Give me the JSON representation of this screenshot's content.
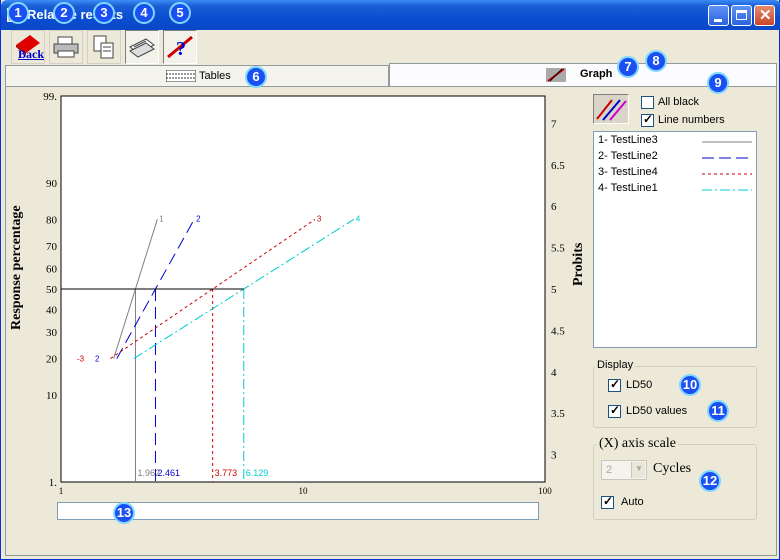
{
  "window": {
    "title": "Relative results"
  },
  "toolbar": {
    "back_label": "Back"
  },
  "tabs": {
    "tables_label": "Tables",
    "graph_label": "Graph"
  },
  "options": {
    "all_black_label": "All black",
    "all_black_checked": false,
    "line_numbers_label": "Line numbers",
    "line_numbers_checked": true
  },
  "legend": [
    {
      "label": "1- TestLine3",
      "color": "#808080",
      "style": "solid"
    },
    {
      "label": "2- TestLine2",
      "color": "#0000cc",
      "style": "dash"
    },
    {
      "label": "3- TestLine4",
      "color": "#cc0000",
      "style": "dot"
    },
    {
      "label": "4- TestLine1",
      "color": "#00cccc",
      "style": "dashdot"
    }
  ],
  "display": {
    "group_label": "Display",
    "ld50_label": "LD50",
    "ld50_checked": true,
    "ld50_values_label": "LD50 values",
    "ld50_values_checked": true
  },
  "xscale": {
    "group_label": "(X) axis scale",
    "cycles_value": "2",
    "cycles_label": "Cycles",
    "auto_label": "Auto",
    "auto_checked": true
  },
  "status_text": "",
  "callouts": [
    "1",
    "2",
    "3",
    "4",
    "5",
    "6",
    "7",
    "8",
    "9",
    "10",
    "11",
    "12",
    "13"
  ],
  "chart_data": {
    "type": "line",
    "title": "",
    "xlabel": "",
    "ylabel": "Response percentage",
    "y2label": "Probits",
    "xscale": "log",
    "xlim": [
      1,
      100
    ],
    "x_ticks": [
      "1",
      "10",
      "100"
    ],
    "ylim_probit": [
      2.67,
      7.33
    ],
    "y_left_ticks": [
      {
        "label": "99.",
        "probit": 7.33
      },
      {
        "label": "90",
        "probit": 6.28
      },
      {
        "label": "80",
        "probit": 5.84
      },
      {
        "label": "70",
        "probit": 5.52
      },
      {
        "label": "60",
        "probit": 5.25
      },
      {
        "label": "50",
        "probit": 5.0
      },
      {
        "label": "40",
        "probit": 4.75
      },
      {
        "label": "30",
        "probit": 4.48
      },
      {
        "label": "20",
        "probit": 4.16
      },
      {
        "label": "10",
        "probit": 3.72
      },
      {
        "label": "1.",
        "probit": 2.67
      }
    ],
    "y_right_ticks": [
      "7",
      "6.5",
      "6",
      "5.5",
      "5",
      "4.5",
      "4",
      "3.5",
      "3"
    ],
    "ld50_probit": 5,
    "series": [
      {
        "name": "1",
        "color": "#808080",
        "dash": "",
        "x": [
          1.65,
          2.5
        ],
        "y": [
          4.16,
          5.84
        ],
        "ld50": "1.962"
      },
      {
        "name": "2",
        "color": "#0000cc",
        "dash": "12,6",
        "x": [
          1.7,
          3.55
        ],
        "y": [
          4.16,
          5.84
        ],
        "ld50": "2.461"
      },
      {
        "name": "3",
        "color": "#cc0000",
        "dash": "3,3",
        "x": [
          1.6,
          11.2
        ],
        "y": [
          4.16,
          5.84
        ],
        "ld50": "3.773"
      },
      {
        "name": "4",
        "color": "#00cccc",
        "dash": "10,3,2,3",
        "x": [
          2.0,
          16.2
        ],
        "y": [
          4.16,
          5.84
        ],
        "ld50": "6.129"
      }
    ]
  }
}
